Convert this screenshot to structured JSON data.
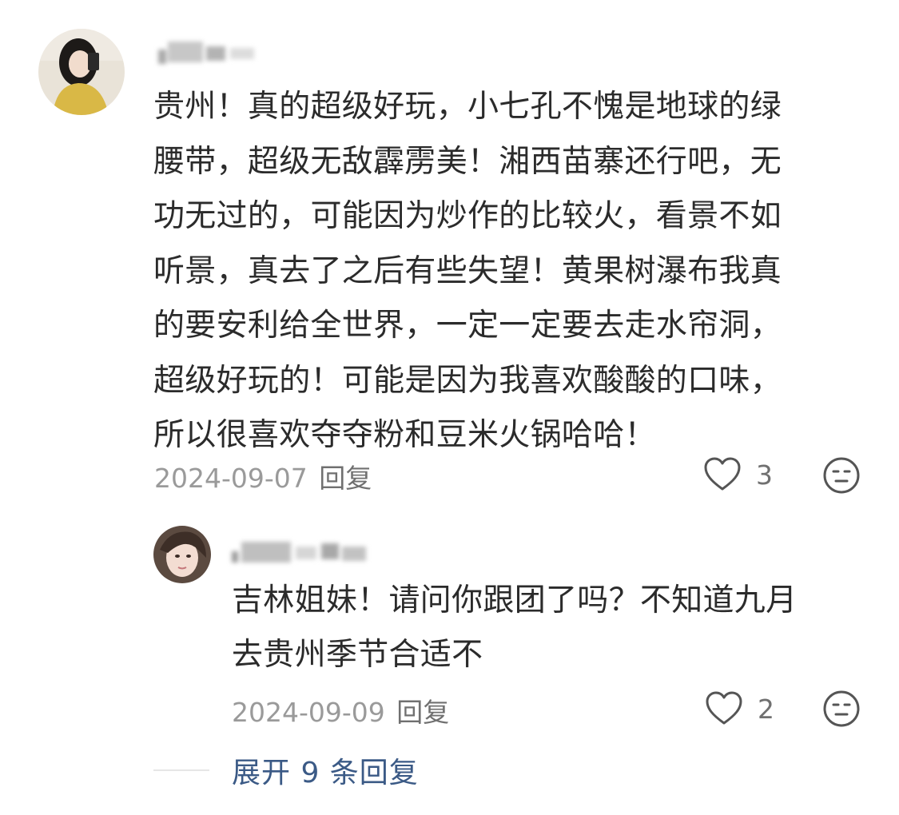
{
  "comment": {
    "avatar": "user-avatar-photo",
    "username_blurred": true,
    "text": "贵州！真的超级好玩，小七孔不愧是地球的绿\n腰带，超级无敌霹雳美！湘西苗寨还行吧，无\n功无过的，可能因为炒作的比较火，看景不如\n听景，真去了之后有些失望！黄果树瀑布我真\n的要安利给全世界，一定一定要去走水帘洞，\n超级好玩的！可能是因为我喜欢酸酸的口味，\n所以很喜欢夺夺粉和豆米火锅哈哈！",
    "date": "2024-09-07",
    "reply_label": "回复",
    "likes": "3",
    "like_icon": "heart-outline-icon",
    "emoji_icon": "neutral-face-icon"
  },
  "reply": {
    "avatar": "user-avatar-photo",
    "username_blurred": true,
    "text": "吉林姐妹！请问你跟团了吗？不知道九月\n去贵州季节合适不",
    "date": "2024-09-09",
    "reply_label": "回复",
    "likes": "2",
    "like_icon": "heart-outline-icon",
    "emoji_icon": "neutral-face-icon"
  },
  "expand_replies": "展开 9 条回复",
  "colors": {
    "text": "#2b2b2b",
    "meta": "#9a9a9a",
    "link": "#3b5a86",
    "background": "#ffffff"
  }
}
